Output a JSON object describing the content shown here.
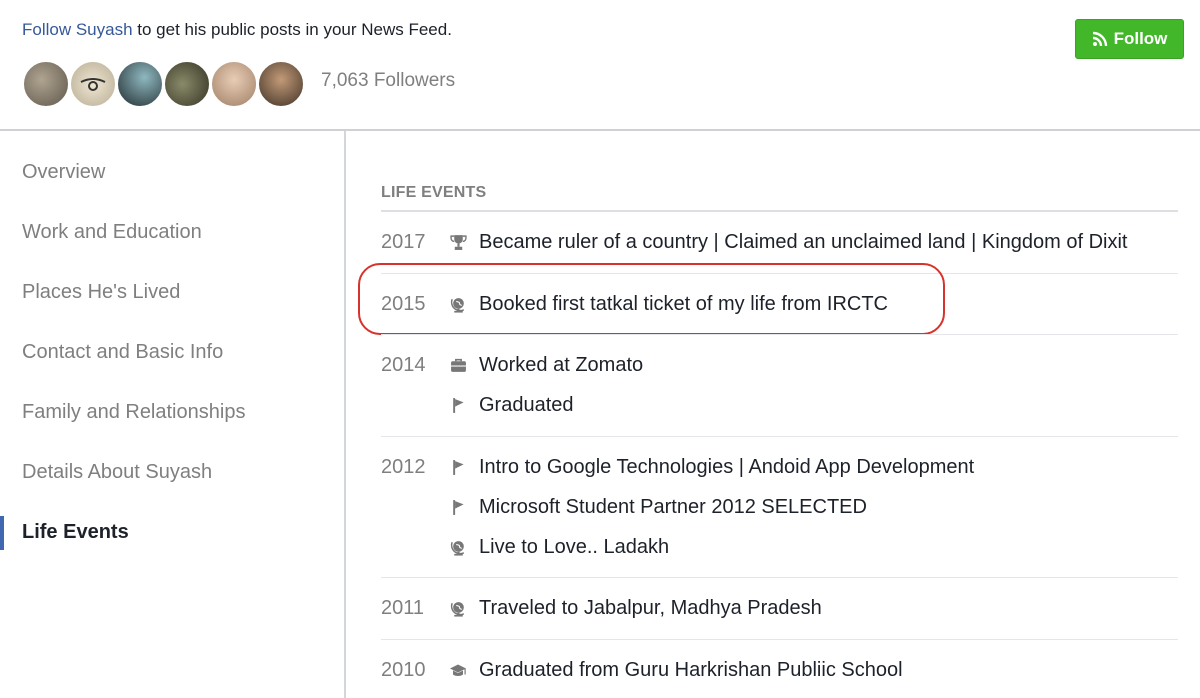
{
  "header": {
    "follow_link": "Follow Suyash",
    "follow_suffix": " to get his public posts in your News Feed.",
    "followers_count": "7,063 Followers",
    "follow_button_label": "Follow",
    "avatar_colors": [
      "#8a8071",
      "#d8cfbd",
      "#2e3b3f",
      "#5b5a44",
      "#c9a891",
      "#7a6650"
    ]
  },
  "sidebar": {
    "items": [
      {
        "label": "Overview"
      },
      {
        "label": "Work and Education"
      },
      {
        "label": "Places He's Lived"
      },
      {
        "label": "Contact and Basic Info"
      },
      {
        "label": "Family and Relationships"
      },
      {
        "label": "Details About Suyash"
      },
      {
        "label": "Life Events",
        "active": true
      }
    ],
    "active_color": "#4267b2"
  },
  "main": {
    "section_title": "LIFE EVENTS",
    "groups": [
      {
        "year": "2017",
        "events": [
          {
            "icon": "trophy-icon",
            "text": "Became ruler of a country | Claimed an unclaimed land | Kingdom of Dixit"
          }
        ]
      },
      {
        "year": "2015",
        "highlighted": true,
        "events": [
          {
            "icon": "globe-icon",
            "text": "Booked first tatkal ticket of my life from IRCTC"
          }
        ]
      },
      {
        "year": "2014",
        "events": [
          {
            "icon": "briefcase-icon",
            "text": "Worked at Zomato"
          },
          {
            "icon": "flag-icon",
            "text": "Graduated"
          }
        ]
      },
      {
        "year": "2012",
        "events": [
          {
            "icon": "flag-icon",
            "text": "Intro to Google Technologies | Andoid App Development"
          },
          {
            "icon": "flag-icon",
            "text": "Microsoft Student Partner 2012 SELECTED"
          },
          {
            "icon": "globe-icon",
            "text": "Live to Love.. Ladakh"
          }
        ]
      },
      {
        "year": "2011",
        "events": [
          {
            "icon": "globe-icon",
            "text": "Traveled to Jabalpur, Madhya Pradesh"
          }
        ]
      },
      {
        "year": "2010",
        "events": [
          {
            "icon": "graduation-cap-icon",
            "text": "Graduated from Guru Harkrishan Publiic School"
          }
        ]
      }
    ],
    "highlight_color": "#d8322c"
  }
}
